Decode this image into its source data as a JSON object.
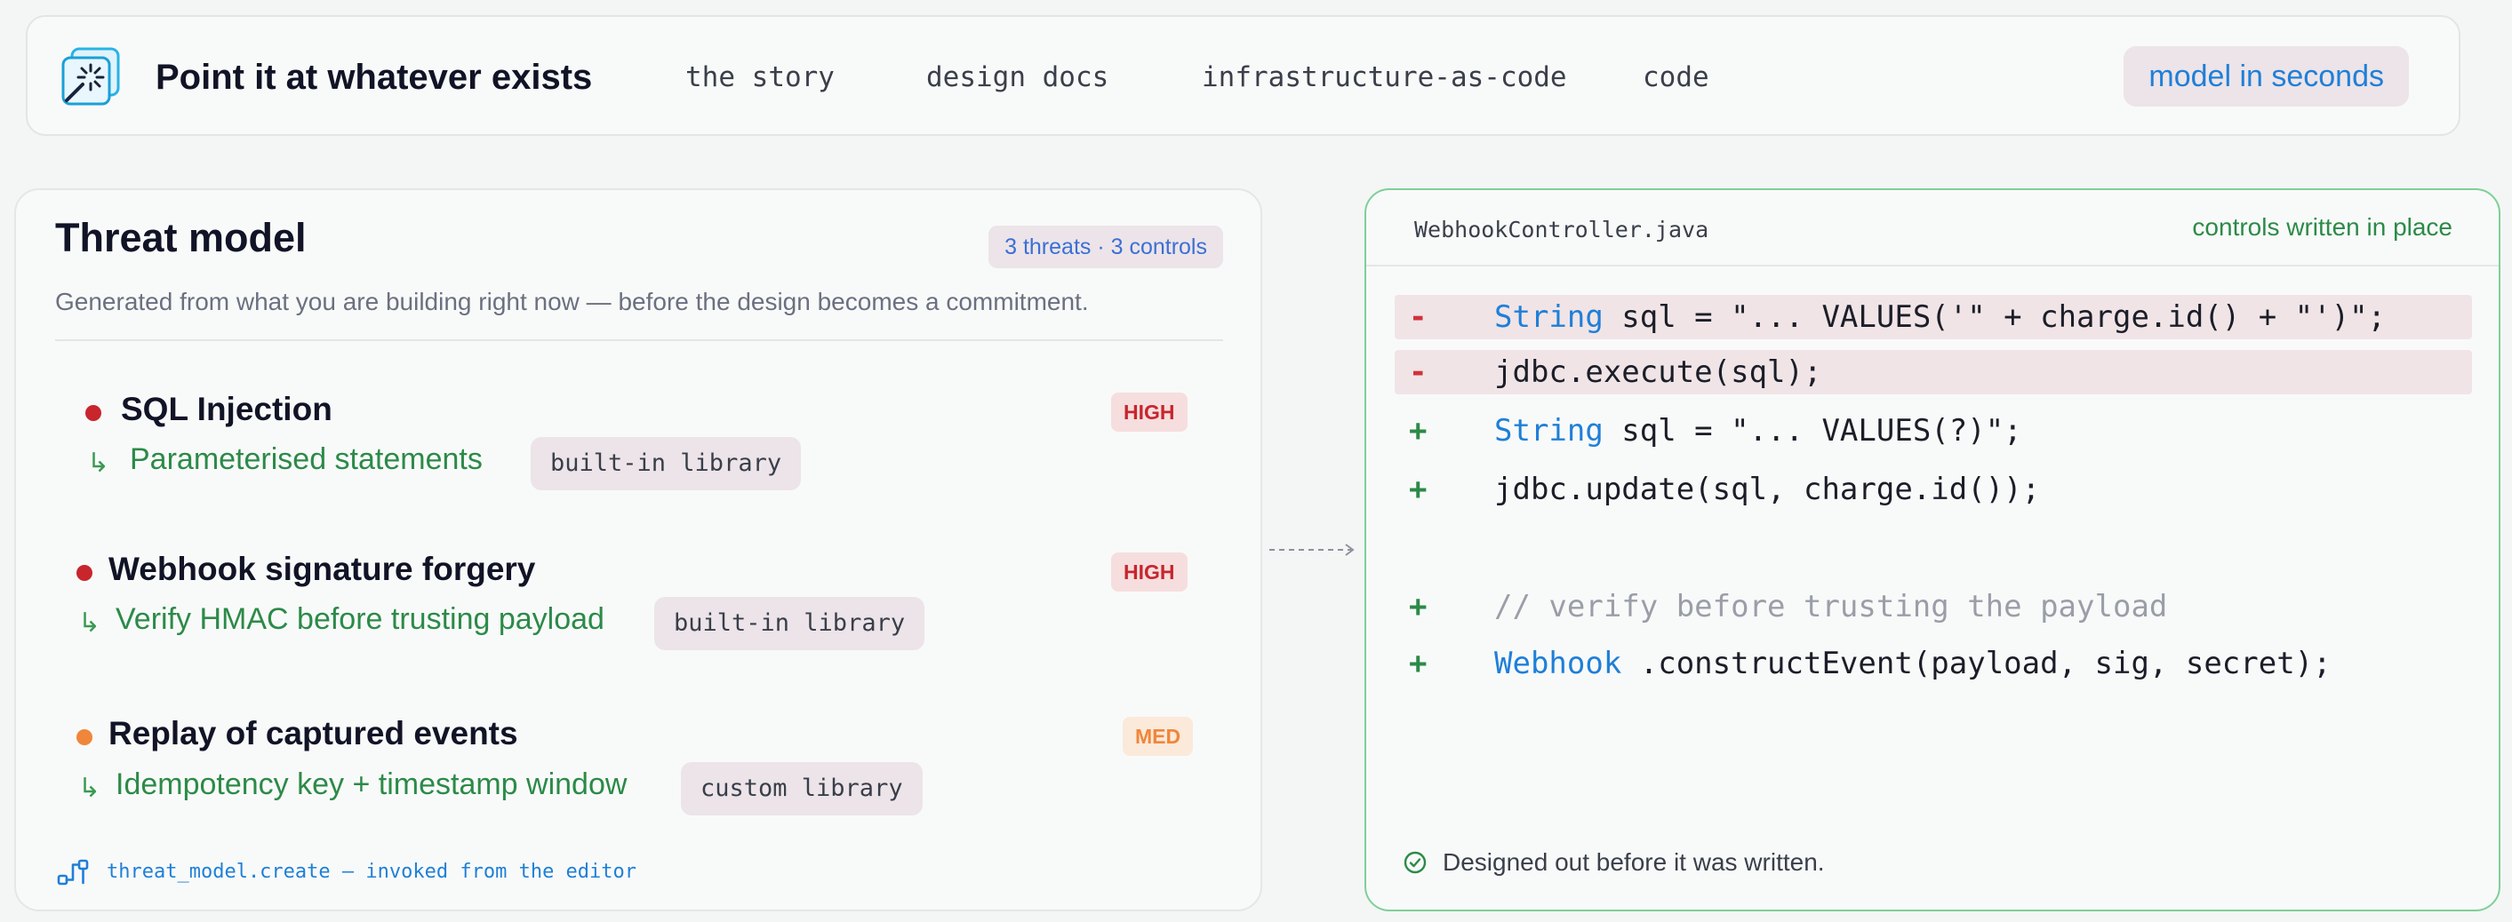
{
  "topbar": {
    "brand": "Point it at whatever exists",
    "nav": [
      "the story",
      "design docs",
      "infrastructure-as-code",
      "code"
    ],
    "cta": "model in seconds"
  },
  "threat_model": {
    "title": "Threat model",
    "count_badge": "3 threats · 3 controls",
    "subtitle": "Generated from what you are building right now — before the design becomes a commitment.",
    "threats": [
      {
        "title": "SQL Injection",
        "severity": "HIGH",
        "severity_color": "#c8252d",
        "control": "Parameterised statements",
        "library": "built-in library"
      },
      {
        "title": "Webhook signature forgery",
        "severity": "HIGH",
        "severity_color": "#c8252d",
        "control": "Verify HMAC before trusting payload",
        "library": "built-in library"
      },
      {
        "title": "Replay of captured events",
        "severity": "MED",
        "severity_color": "#f0863a",
        "control": "Idempotency key + timestamp window",
        "library": "custom library"
      }
    ],
    "footer": "threat_model.create — invoked from the editor"
  },
  "code_panel": {
    "file_name": "WebhookController.java",
    "status": "controls written in place",
    "lines": [
      {
        "marker": "-",
        "kind": "del",
        "keyword": "String",
        "text": " sql = \"... VALUES('\" + charge.id() + \"')\";"
      },
      {
        "marker": "-",
        "kind": "del",
        "keyword": "",
        "text": "jdbc.execute(sql);"
      },
      {
        "marker": "+",
        "kind": "add",
        "keyword": "String",
        "text": " sql = \"... VALUES(?)\";"
      },
      {
        "marker": "+",
        "kind": "add",
        "keyword": "",
        "text": "jdbc.update(sql, charge.id());"
      },
      {
        "marker": "+",
        "kind": "add",
        "comment": "// verify before trusting the payload"
      },
      {
        "marker": "+",
        "kind": "add",
        "keyword": "Webhook",
        "text": " .constructEvent(payload, sig, secret);"
      }
    ],
    "footer": "Designed out before it was written."
  },
  "colors": {
    "accent_blue": "#1f7fd8",
    "success_green": "#2c8a48",
    "high": "#c8252d",
    "medium": "#f0863a"
  },
  "icons": [
    "app-logo-icon",
    "bullet-dot-icon",
    "return-arrow-icon",
    "workflow-icon",
    "dashed-arrow-icon",
    "check-circle-icon"
  ]
}
